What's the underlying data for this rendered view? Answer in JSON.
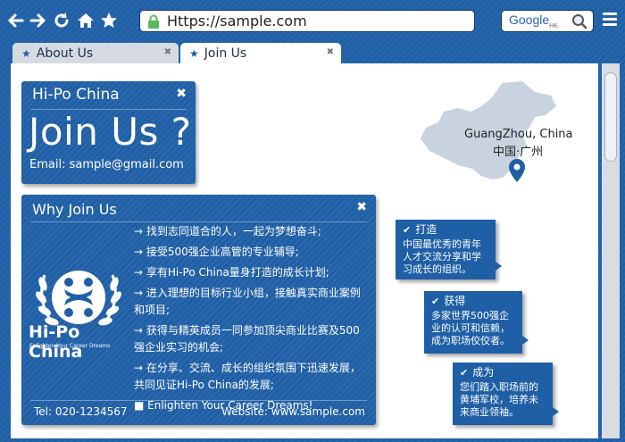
{
  "browser": {
    "url": "Https://sample.com",
    "search_brand": "Google",
    "search_region": "HK",
    "tabs": [
      {
        "label": "About Us"
      },
      {
        "label": "Join Us"
      }
    ]
  },
  "hipo_card": {
    "title": "Hi-Po China",
    "headline": "Join Us ?",
    "email": "Email: sample@gmail.com"
  },
  "why_card": {
    "title": "Why Join Us",
    "logo_name": "Hi-Po China",
    "logo_tagline": "Enlighten Your Career Dreams",
    "items": [
      "→ 找到志同道合的人，一起为梦想奋斗;",
      "→ 接受500强企业高管的专业辅导;",
      "→ 享有Hi-Po China量身打造的成长计划;",
      "→ 进入理想的目标行业小组，接触真实商业案例和项目;",
      "→ 获得与精英成员一同参加顶尖商业比赛及500强企业实习的机会;",
      "→ 在分享、交流、成长的组织氛围下迅速发展，共同见证Hi-Po China的发展;",
      "■ Enlighten Your Career Dreams!"
    ],
    "tel": "Tel: 020-1234567",
    "website": "Website: www.sample.com"
  },
  "map": {
    "city": "GuangZhou, China",
    "city_cn": "中国·广州"
  },
  "notes": [
    {
      "title": "打造",
      "text": "中国最优秀的青年人才交流分享和学习成长的组织。"
    },
    {
      "title": "获得",
      "text": "多家世界500强企业的认可和信赖，成为职场佼佼者。"
    },
    {
      "title": "成为",
      "text": "您们踏入职场前的黄埔军校，培养未来商业领袖。"
    }
  ],
  "colors": {
    "brand_blue": "#1f5fa6",
    "tab_inactive": "#d6dbe3"
  },
  "icons": [
    "back-icon",
    "forward-icon",
    "refresh-icon",
    "home-icon",
    "star-icon",
    "lock-icon",
    "search-icon",
    "menu-icon",
    "close-icon",
    "check-icon",
    "location-pin-icon"
  ]
}
